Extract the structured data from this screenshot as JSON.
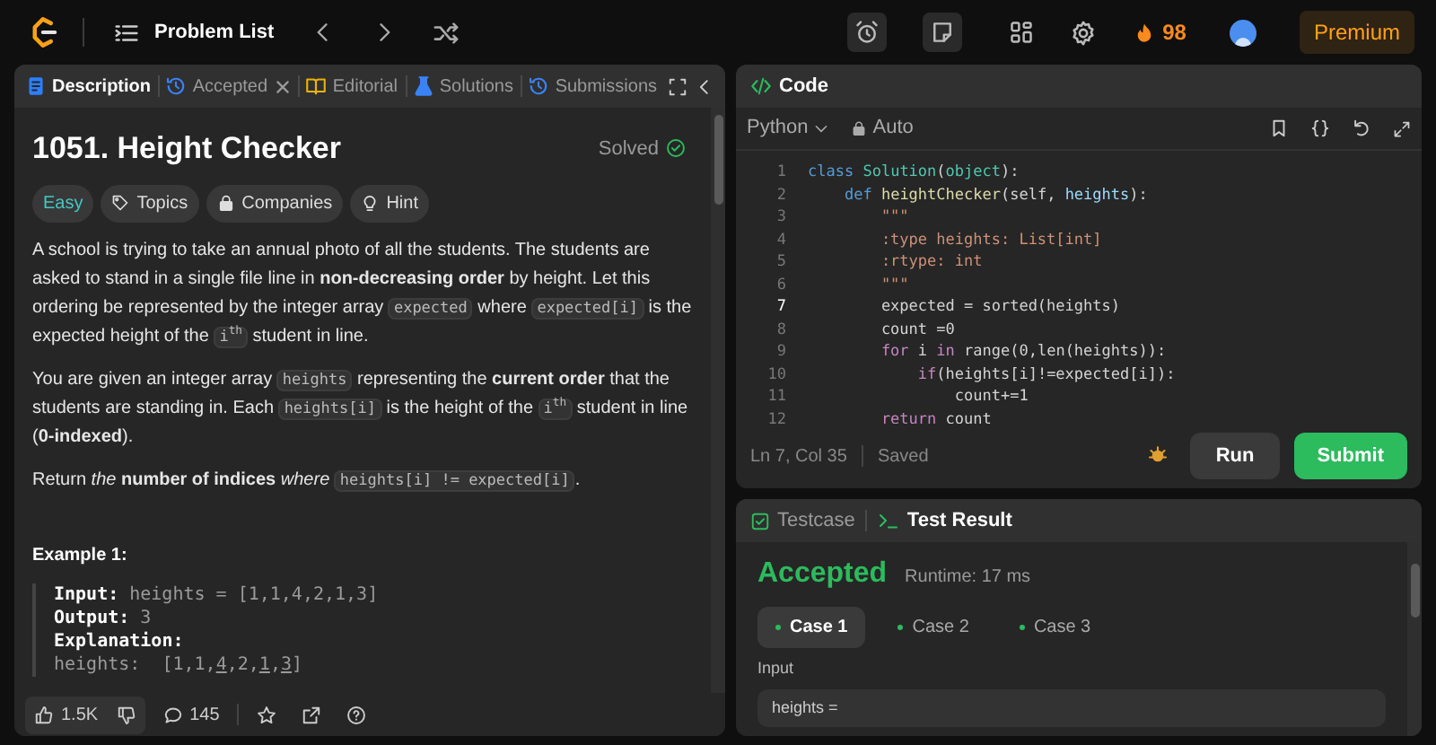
{
  "top_bar": {
    "title": "Problem List",
    "streak": "98",
    "premium": "Premium"
  },
  "left_tabs": [
    {
      "label": "Description",
      "selected": true,
      "closable": false
    },
    {
      "label": "Accepted",
      "selected": false,
      "closable": true
    },
    {
      "label": "Editorial",
      "selected": false,
      "closable": false
    },
    {
      "label": "Solutions",
      "selected": false,
      "closable": false
    },
    {
      "label": "Submissions",
      "selected": false,
      "closable": false
    }
  ],
  "problem": {
    "title": "1051. Height Checker",
    "status": "Solved",
    "difficulty": "Easy",
    "tags": [
      {
        "label": "Topics"
      },
      {
        "label": "Companies"
      },
      {
        "label": "Hint"
      }
    ],
    "paragraphs": [
      [
        {
          "kind": "text",
          "text": "A school is trying to take an annual photo of all the students. The students are asked to stand in a single file line in **non-decreasing order** by height. Let this ordering be represented by the integer array "
        },
        {
          "kind": "code",
          "text": "expected"
        },
        {
          "kind": "text",
          "text": " where "
        },
        {
          "kind": "code",
          "text": "expected[i]"
        },
        {
          "kind": "text",
          "text": " is the expected height of the "
        },
        {
          "kind": "code",
          "text": "i$^{th}$"
        },
        {
          "kind": "text",
          "text": " student in line."
        }
      ],
      [
        {
          "kind": "text",
          "text": "You are given an integer array "
        },
        {
          "kind": "code",
          "text": "heights"
        },
        {
          "kind": "text",
          "text": " representing the **current order** that the students are standing in. Each "
        },
        {
          "kind": "code",
          "text": "heights[i]"
        },
        {
          "kind": "text",
          "text": " is the height of the "
        },
        {
          "kind": "code",
          "text": "i$^{th}$"
        },
        {
          "kind": "text",
          "text": " student in line (**0-indexed**)."
        }
      ],
      [
        {
          "kind": "text",
          "text": "Return *the* **number of indices** *where* "
        },
        {
          "kind": "code",
          "text": "heights[i] != expected[i]"
        },
        {
          "kind": "text",
          "text": "."
        }
      ]
    ],
    "example": {
      "title": "Example 1:",
      "lines": [
        {
          "label": "Input:",
          "parts": [
            {
              "text": "heights = [1,1,4,2,1,3]",
              "underlined": false
            }
          ]
        },
        {
          "label": "Output:",
          "parts": [
            {
              "text": "3",
              "underlined": false
            }
          ]
        },
        {
          "label": "Explanation:"
        },
        {
          "parts": [
            {
              "text": "heights:  [1,1,",
              "underlined": false
            },
            {
              "text": "4",
              "underlined": true
            },
            {
              "text": ",2,",
              "underlined": false
            },
            {
              "text": "1",
              "underlined": true
            },
            {
              "text": ",",
              "underlined": false
            },
            {
              "text": "3",
              "underlined": true
            },
            {
              "text": "]",
              "underlined": false
            }
          ]
        }
      ]
    }
  },
  "footer": {
    "likes": "1.5K",
    "comments": "145"
  },
  "code_panel": {
    "title": "Code",
    "language": "Python",
    "mode": "Auto",
    "cursor": "Ln 7, Col 35",
    "save_state": "Saved",
    "run": "Run",
    "submit": "Submit",
    "lines": [
      {
        "number": "1",
        "current": false,
        "tokens": [
          {
            "kind": "kw",
            "text": "class "
          },
          {
            "kind": "cls",
            "text": "Solution"
          },
          {
            "kind": "plain",
            "text": "("
          },
          {
            "kind": "cls",
            "text": "object"
          },
          {
            "kind": "plain",
            "text": "):"
          }
        ]
      },
      {
        "number": "2",
        "current": false,
        "tokens": [
          {
            "kind": "kw",
            "text": "    def "
          },
          {
            "kind": "fn",
            "text": "heightChecker"
          },
          {
            "kind": "plain",
            "text": "(self, "
          },
          {
            "kind": "var",
            "text": "heights"
          },
          {
            "kind": "plain",
            "text": "):"
          }
        ]
      },
      {
        "number": "3",
        "current": false,
        "tokens": [
          {
            "kind": "str",
            "text": "        \"\"\""
          }
        ]
      },
      {
        "number": "4",
        "current": false,
        "tokens": [
          {
            "kind": "str",
            "text": "        :type heights: List[int]"
          }
        ]
      },
      {
        "number": "5",
        "current": false,
        "tokens": [
          {
            "kind": "str",
            "text": "        :rtype: int"
          }
        ]
      },
      {
        "number": "6",
        "current": false,
        "tokens": [
          {
            "kind": "str",
            "text": "        \"\"\""
          }
        ]
      },
      {
        "number": "7",
        "current": true,
        "tokens": [
          {
            "kind": "plain",
            "text": "        expected = sorted(heights)"
          }
        ]
      },
      {
        "number": "8",
        "current": false,
        "tokens": [
          {
            "kind": "plain",
            "text": "        count =0"
          }
        ]
      },
      {
        "number": "9",
        "current": false,
        "tokens": [
          {
            "kind": "ctl",
            "text": "        for"
          },
          {
            "kind": "plain",
            "text": " i "
          },
          {
            "kind": "ctl",
            "text": "in"
          },
          {
            "kind": "plain",
            "text": " range(0,len(heights)):"
          }
        ]
      },
      {
        "number": "10",
        "current": false,
        "tokens": [
          {
            "kind": "ctl",
            "text": "            if"
          },
          {
            "kind": "plain",
            "text": "(heights[i]!=expected[i]):"
          }
        ]
      },
      {
        "number": "11",
        "current": false,
        "tokens": [
          {
            "kind": "plain",
            "text": "                count+=1"
          }
        ]
      },
      {
        "number": "12",
        "current": false,
        "tokens": [
          {
            "kind": "ctl",
            "text": "        return"
          },
          {
            "kind": "plain",
            "text": " count"
          }
        ]
      }
    ]
  },
  "result_panel": {
    "tabs": [
      {
        "label": "Testcase",
        "selected": false
      },
      {
        "label": "Test Result",
        "selected": true
      }
    ],
    "verdict": "Accepted",
    "runtime": "Runtime: 17 ms",
    "cases": [
      {
        "label": "Case 1",
        "selected": true
      },
      {
        "label": "Case 2",
        "selected": false
      },
      {
        "label": "Case 3",
        "selected": false
      }
    ],
    "input_label": "Input",
    "input_value": "heights ="
  }
}
